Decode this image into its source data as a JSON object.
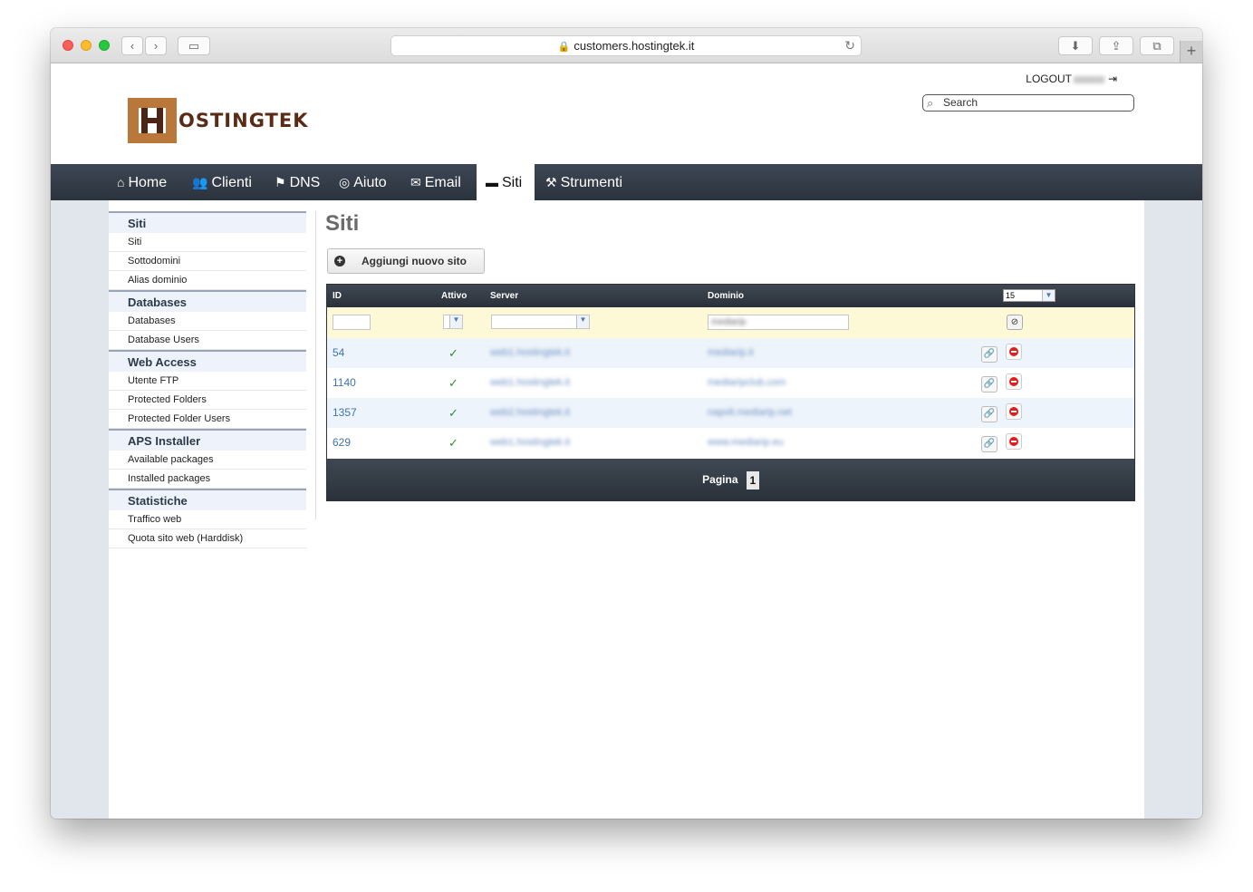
{
  "browser": {
    "url": "customers.hostingtek.it"
  },
  "header": {
    "logout_label": "LOGOUT",
    "search_placeholder": "Search",
    "logo_text": "OSTINGTEK"
  },
  "nav": {
    "items": [
      {
        "label": "Home",
        "icon": "home-icon"
      },
      {
        "label": "Clienti",
        "icon": "users-icon"
      },
      {
        "label": "DNS",
        "icon": "signpost-icon"
      },
      {
        "label": "Aiuto",
        "icon": "lifebuoy-icon"
      },
      {
        "label": "Email",
        "icon": "envelope-icon"
      },
      {
        "label": "Siti",
        "icon": "folder-icon",
        "active": true
      },
      {
        "label": "Strumenti",
        "icon": "tools-icon"
      }
    ]
  },
  "sidebar": {
    "sections": [
      {
        "title": "Siti",
        "items": [
          "Siti",
          "Sottodomini",
          "Alias dominio"
        ]
      },
      {
        "title": "Databases",
        "items": [
          "Databases",
          "Database Users"
        ]
      },
      {
        "title": "Web Access",
        "items": [
          "Utente FTP",
          "Protected Folders",
          "Protected Folder Users"
        ]
      },
      {
        "title": "APS Installer",
        "items": [
          "Available packages",
          "Installed packages"
        ]
      },
      {
        "title": "Statistiche",
        "items": [
          "Traffico web",
          "Quota sito web (Harddisk)"
        ]
      }
    ]
  },
  "main": {
    "title": "Siti",
    "add_button": "Aggiungi nuovo sito",
    "table": {
      "columns": [
        "ID",
        "Attivo",
        "Server",
        "Dominio"
      ],
      "page_size": "15",
      "filter_domain": "mediarip",
      "rows": [
        {
          "id": "54",
          "active": "✓",
          "server": "web1.hostingtek.it",
          "domain": "mediarip.it"
        },
        {
          "id": "1140",
          "active": "✓",
          "server": "web1.hostingtek.it",
          "domain": "mediaripclub.com"
        },
        {
          "id": "1357",
          "active": "✓",
          "server": "web2.hostingtek.it",
          "domain": "napoli.mediarip.net"
        },
        {
          "id": "629",
          "active": "✓",
          "server": "web1.hostingtek.it",
          "domain": "www.mediarip.eu"
        }
      ],
      "pager_label": "Pagina",
      "current_page": "1"
    }
  }
}
